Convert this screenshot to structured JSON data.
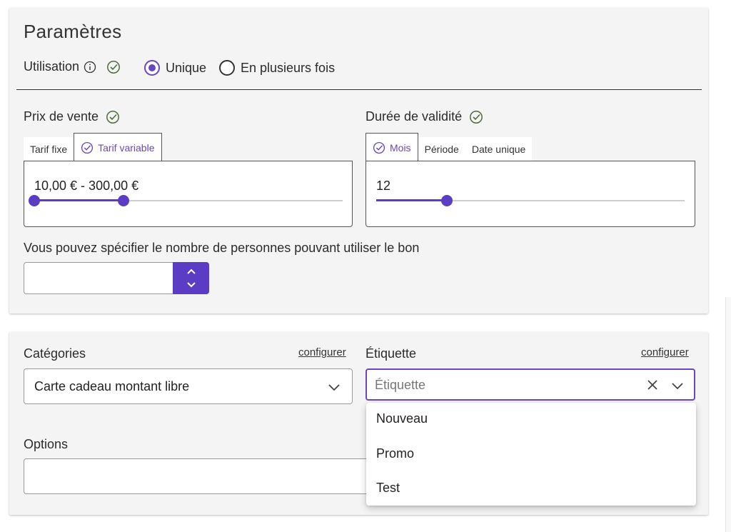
{
  "params": {
    "title": "Paramètres",
    "usage": {
      "label": "Utilisation",
      "options": [
        {
          "label": "Unique",
          "selected": true
        },
        {
          "label": "En plusieurs fois",
          "selected": false
        }
      ]
    },
    "price": {
      "label": "Prix de vente",
      "tabs": [
        "Tarif fixe",
        "Tarif variable"
      ],
      "active_tab": "Tarif variable",
      "range_text": "10,00 € - 300,00 €",
      "range_low_fraction": 0.0,
      "range_high_fraction": 0.29
    },
    "validity": {
      "label": "Durée de validité",
      "tabs": [
        "Mois",
        "Période",
        "Date unique"
      ],
      "active_tab": "Mois",
      "value": "12",
      "slider_fraction": 0.23
    },
    "persons": {
      "label": "Vous pouvez spécifier le nombre de personnes pouvant utiliser le bon",
      "value": "",
      "up_glyph": "^",
      "down_glyph": "v"
    }
  },
  "categories": {
    "label": "Catégories",
    "configure_label": "configurer",
    "selected": "Carte cadeau montant libre"
  },
  "tag": {
    "label": "Étiquette",
    "configure_label": "configurer",
    "placeholder": "Étiquette",
    "options": [
      "Nouveau",
      "Promo",
      "Test"
    ]
  },
  "options": {
    "label": "Options",
    "value": ""
  },
  "colors": {
    "accent": "#6b46c1",
    "slider": "#5b3cc4",
    "check": "#4f6b3a"
  }
}
